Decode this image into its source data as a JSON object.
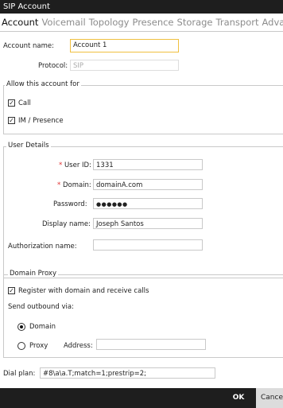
{
  "window": {
    "title": "SIP Account"
  },
  "tabs": [
    {
      "label": "Account",
      "active": true
    },
    {
      "label": "Voicemail",
      "active": false
    },
    {
      "label": "Topology",
      "active": false
    },
    {
      "label": "Presence",
      "active": false
    },
    {
      "label": "Storage",
      "active": false
    },
    {
      "label": "Transport",
      "active": false
    },
    {
      "label": "Advanc",
      "active": false
    }
  ],
  "account": {
    "name_label": "Account name:",
    "name_value": "Account 1",
    "protocol_label": "Protocol:",
    "protocol_value": "SIP"
  },
  "allow": {
    "legend": "Allow this account for",
    "call_label": "Call",
    "call_checked": true,
    "im_label": "IM / Presence",
    "im_checked": true
  },
  "user": {
    "legend": "User Details",
    "user_id_label": "User ID:",
    "user_id_value": "1331",
    "domain_label": "Domain:",
    "domain_value": "domainA.com",
    "password_label": "Password:",
    "password_value": "●●●●●●",
    "display_label": "Display name:",
    "display_value": "Joseph Santos",
    "auth_label": "Authorization name:",
    "auth_value": "",
    "required_mark": "*"
  },
  "proxy": {
    "legend": "Domain Proxy",
    "register_label": "Register with domain and receive calls",
    "register_checked": true,
    "outbound_label": "Send outbound via:",
    "domain_radio_label": "Domain",
    "proxy_radio_label": "Proxy",
    "address_label": "Address:",
    "address_value": "",
    "selected": "Domain"
  },
  "dial": {
    "label": "Dial plan:",
    "value": "#8\\a\\a.T;match=1;prestrip=2;"
  },
  "buttons": {
    "ok": "OK",
    "cancel": "Cancel"
  },
  "icons": {
    "check": "✓"
  }
}
